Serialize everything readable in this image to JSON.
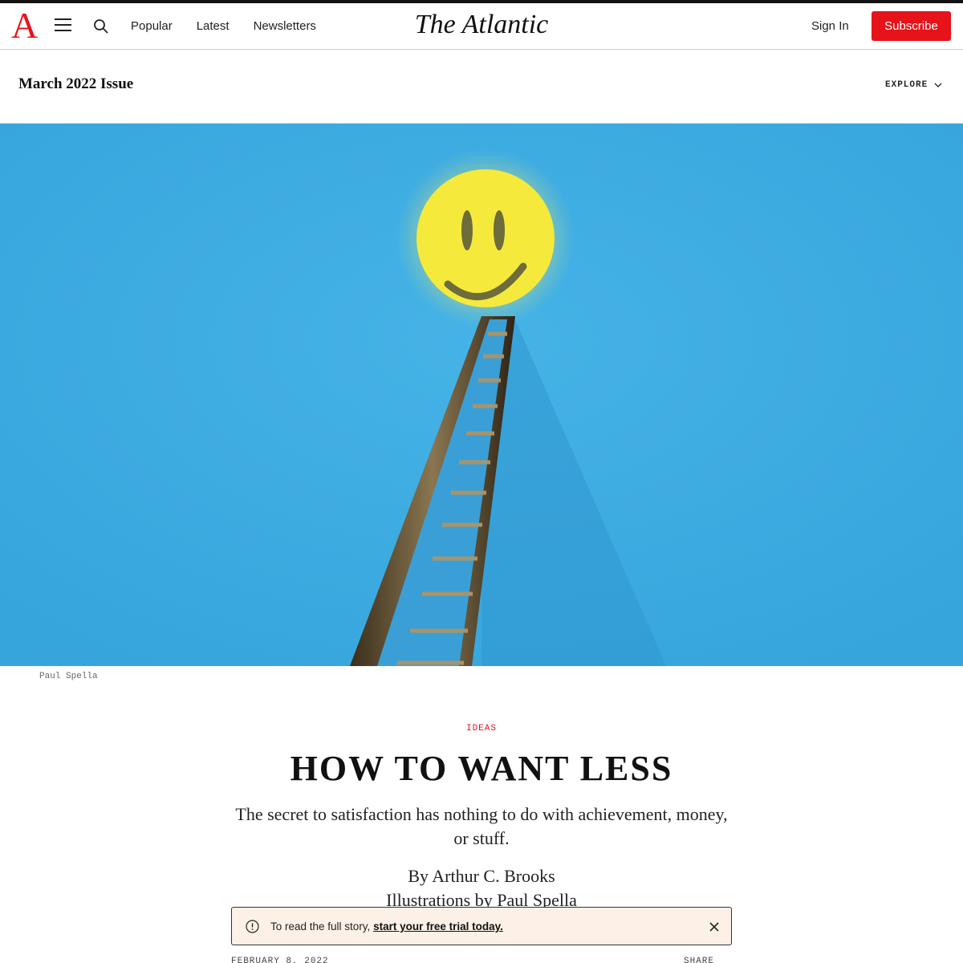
{
  "header": {
    "logo_letter": "A",
    "nav": [
      "Popular",
      "Latest",
      "Newsletters"
    ],
    "wordmark": "The Atlantic",
    "sign_in": "Sign In",
    "subscribe": "Subscribe"
  },
  "issue_bar": {
    "title": "March 2022 Issue",
    "explore_label": "EXPLORE"
  },
  "hero": {
    "caption": "Paul Spella"
  },
  "article": {
    "rubric": "IDEAS",
    "headline": "HOW TO WANT LESS",
    "dek": "The secret to satisfaction has nothing to do with achievement, money, or stuff.",
    "byline": "By Arthur C. Brooks",
    "illustrations": "Illustrations by Paul Spella",
    "date": "FEBRUARY 8, 2022",
    "share": "SHARE"
  },
  "paywall": {
    "text": "To read the full story,",
    "link": "start your free trial today."
  },
  "colors": {
    "brand_red": "#e7131a",
    "sky_blue": "#3aa7dc",
    "smiley_yellow": "#f3e63a",
    "paywall_bg": "#fdf1e7"
  },
  "icons": [
    "menu-icon",
    "search-icon",
    "chevron-down-icon",
    "info-icon",
    "close-icon"
  ]
}
